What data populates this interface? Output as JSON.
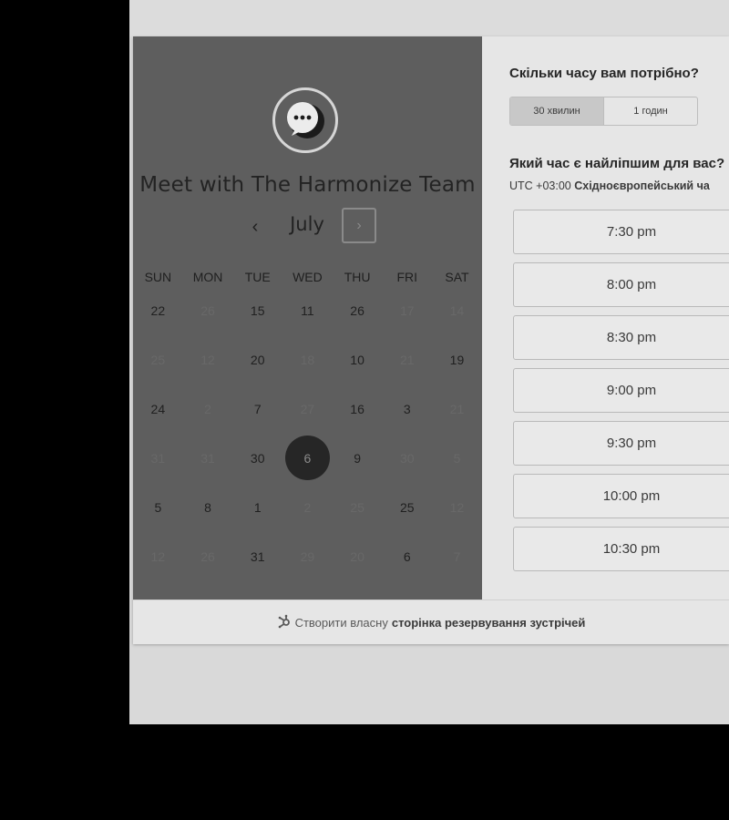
{
  "left": {
    "title": "Meet with The Harmonize Team",
    "month": "July",
    "prev_glyph": "‹",
    "next_glyph": "›",
    "weekdays": [
      "SUN",
      "MON",
      "TUE",
      "WED",
      "THU",
      "FRI",
      "SAT"
    ],
    "weeks": [
      [
        {
          "d": "22",
          "s": "active"
        },
        {
          "d": "26",
          "s": "inactive"
        },
        {
          "d": "15",
          "s": "active"
        },
        {
          "d": "11",
          "s": "active"
        },
        {
          "d": "26",
          "s": "active"
        },
        {
          "d": "17",
          "s": "inactive"
        },
        {
          "d": "14",
          "s": "inactive"
        }
      ],
      [
        {
          "d": "25",
          "s": "inactive"
        },
        {
          "d": "12",
          "s": "inactive"
        },
        {
          "d": "20",
          "s": "active"
        },
        {
          "d": "18",
          "s": "inactive"
        },
        {
          "d": "10",
          "s": "active"
        },
        {
          "d": "21",
          "s": "inactive"
        },
        {
          "d": "19",
          "s": "active"
        }
      ],
      [
        {
          "d": "24",
          "s": "active"
        },
        {
          "d": "2",
          "s": "inactive"
        },
        {
          "d": "7",
          "s": "active"
        },
        {
          "d": "27",
          "s": "inactive"
        },
        {
          "d": "16",
          "s": "active"
        },
        {
          "d": "3",
          "s": "active"
        },
        {
          "d": "21",
          "s": "inactive"
        }
      ],
      [
        {
          "d": "31",
          "s": "inactive"
        },
        {
          "d": "31",
          "s": "inactive"
        },
        {
          "d": "30",
          "s": "active"
        },
        {
          "d": "6",
          "s": "selected"
        },
        {
          "d": "9",
          "s": "active"
        },
        {
          "d": "30",
          "s": "inactive"
        },
        {
          "d": "5",
          "s": "inactive"
        }
      ],
      [
        {
          "d": "5",
          "s": "active"
        },
        {
          "d": "8",
          "s": "active"
        },
        {
          "d": "1",
          "s": "active"
        },
        {
          "d": "2",
          "s": "inactive"
        },
        {
          "d": "25",
          "s": "inactive"
        },
        {
          "d": "25",
          "s": "active"
        },
        {
          "d": "12",
          "s": "inactive"
        }
      ],
      [
        {
          "d": "12",
          "s": "inactive"
        },
        {
          "d": "26",
          "s": "inactive"
        },
        {
          "d": "31",
          "s": "active"
        },
        {
          "d": "29",
          "s": "inactive"
        },
        {
          "d": "20",
          "s": "inactive"
        },
        {
          "d": "6",
          "s": "active"
        },
        {
          "d": "7",
          "s": "inactive"
        }
      ]
    ]
  },
  "right": {
    "duration_heading": "Скільки часу вам потрібно?",
    "duration_options": [
      "30 хвилин",
      "1 годин"
    ],
    "time_heading": "Який час є найліпшим для вас?",
    "tz_offset": "UTC +03:00",
    "tz_name": "Східноєвропейський ча",
    "slots": [
      "7:30 pm",
      "8:00 pm",
      "8:30 pm",
      "9:00 pm",
      "9:30 pm",
      "10:00 pm",
      "10:30 pm"
    ]
  },
  "footer": {
    "prefix": "Створити власну",
    "bold": "сторінка резервування зустрічей"
  },
  "icons": {
    "avatar": "chat-bubble-icon",
    "footer": "sprocket-icon"
  }
}
